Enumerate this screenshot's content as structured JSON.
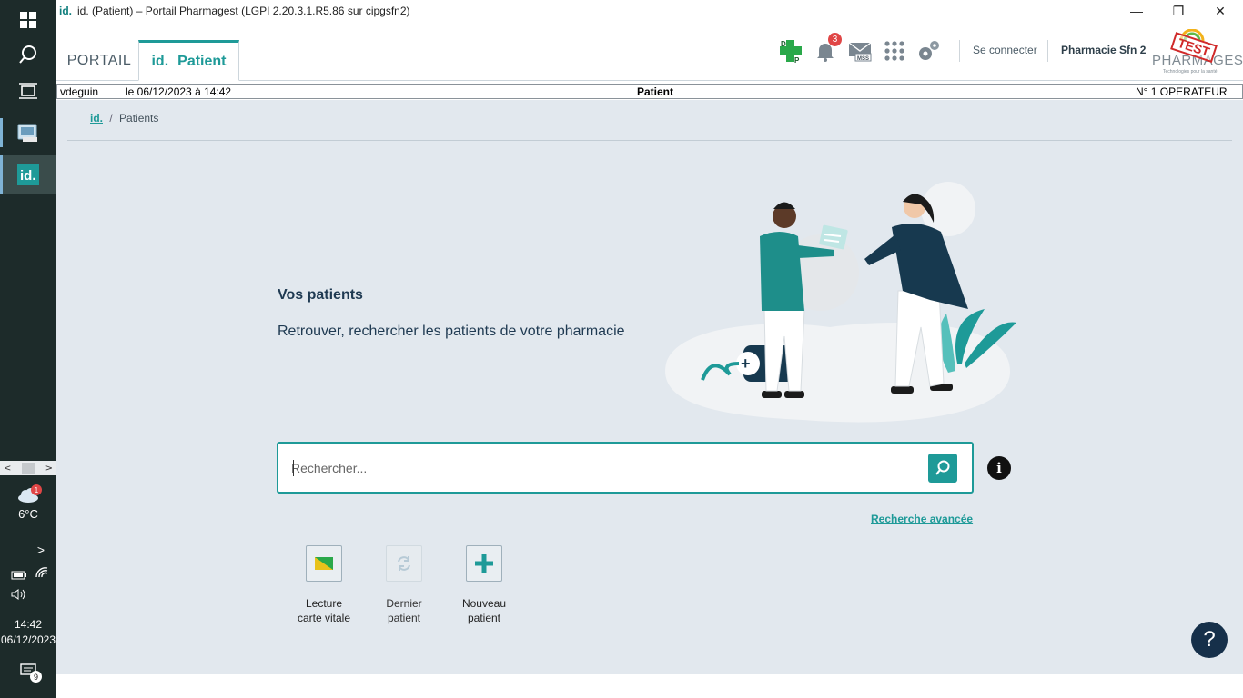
{
  "window": {
    "logo": "id.",
    "title": "id. (Patient) – Portail Pharmagest (LGPI 2.20.3.1.R5.86 sur cipgsfn2)",
    "minimize": "—",
    "restore": "❐",
    "close": "✕"
  },
  "tabs": [
    {
      "label": "PORTAIL"
    },
    {
      "logo": "id.",
      "label": "Patient"
    }
  ],
  "header": {
    "notification_count": "3",
    "mss_label": "MSS",
    "login_link": "Se connecter",
    "pharmacy_name": "Pharmacie Sfn 2",
    "brand_name": "PHARMAGEST",
    "brand_tagline": "Technologies pour la santé",
    "test_stamp": "TEST",
    "icons": [
      "dp-cross-icon",
      "bell-icon",
      "mail-mss-icon",
      "apps-grid-icon",
      "settings-gears-icon"
    ]
  },
  "status_bar": {
    "user": "vdeguin",
    "datetime": "le 06/12/2023 à 14:42",
    "module": "Patient",
    "operator": "N° 1 OPERATEUR"
  },
  "breadcrumb": {
    "root": "id.",
    "separator": "/",
    "current": "Patients"
  },
  "hero": {
    "title": "Vos patients",
    "subtitle": "Retrouver, rechercher les patients de votre pharmacie"
  },
  "search": {
    "placeholder": "Rechercher...",
    "value": "",
    "advanced_link": "Recherche avancée"
  },
  "actions": [
    {
      "line1": "Lecture",
      "line2": "carte vitale",
      "icon": "vitale-card-icon",
      "enabled": true
    },
    {
      "line1": "Dernier",
      "line2": "patient",
      "icon": "refresh-icon",
      "enabled": false
    },
    {
      "line1": "Nouveau",
      "line2": "patient",
      "icon": "plus-icon",
      "enabled": true
    }
  ],
  "help": {
    "label": "?"
  },
  "info": {
    "label": "i"
  },
  "taskbar": {
    "scroll_left": "<",
    "scroll_right": ">",
    "weather_badge": "1",
    "weather_temp": "6°C",
    "expand": ">",
    "time": "14:42",
    "date": "06/12/2023",
    "notification_count": "9",
    "colors": {
      "background": "#1d2b2a",
      "accent": "#1e9a98"
    }
  },
  "colors": {
    "accent": "#1e9a98",
    "content_background": "#e2e8ee",
    "navy": "#16304a",
    "badge": "#e04646"
  }
}
